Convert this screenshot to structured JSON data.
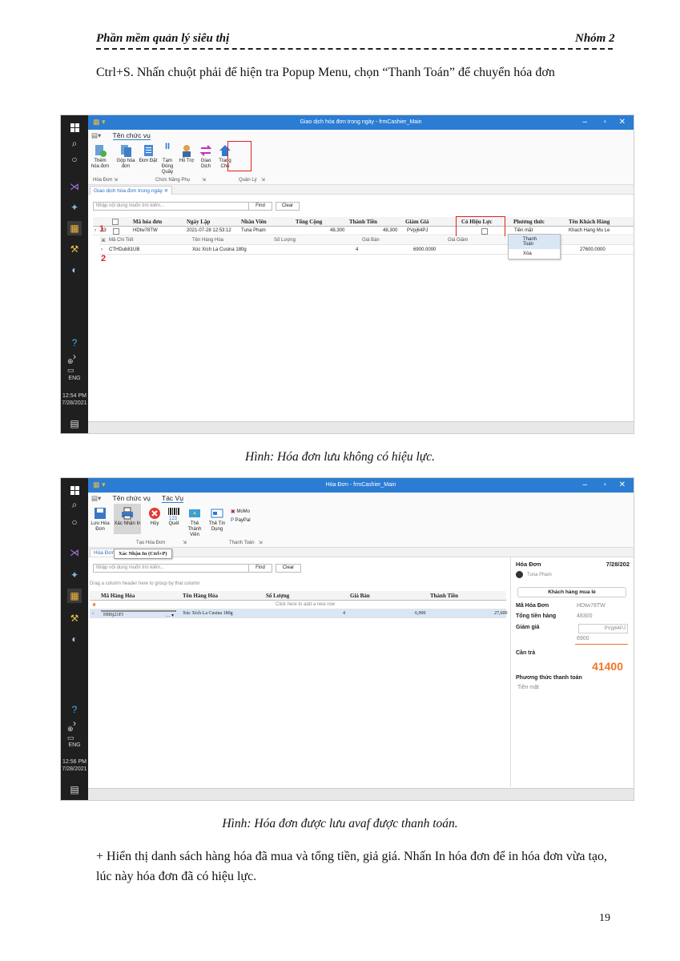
{
  "header": {
    "left": "Phần mềm quản lý siêu thị",
    "right": "Nhóm 2"
  },
  "intro": "Ctrl+S. Nhấn chuột phải để hiện tra Popup Menu, chọn “Thanh Toán” để chuyển hóa đơn",
  "fig1": {
    "window_title": "Giao dịch hóa đơn trong ngày - frmCashier_Main",
    "ribbon_tab": "Tên chức vụ",
    "buttons": [
      "Thêm hóa đơn",
      "Gộp hóa đơn",
      "Đơn Đặt",
      "Tạm Đóng Quầy",
      "Hỗ Trợ",
      "Giao Dịch",
      "Trang Chủ"
    ],
    "groups": [
      "Hóa Đơn",
      "Chức Năng Phụ",
      "Quản Lý"
    ],
    "doc_tab": "Giao dịch hóa đơn trong ngày",
    "search_placeholder": "Nhập nội dung muốn tìm kiếm...",
    "find": "Find",
    "clear": "Clear",
    "columns": [
      "Mã hóa đơn",
      "Ngày Lập",
      "Nhân Viên",
      "Tổng Cộng",
      "Thành Tiền",
      "Giảm Giá",
      "Có Hiệu Lực",
      "Phương thức",
      "Tên Khách Hàng"
    ],
    "row": {
      "ma": "HDtw78TW",
      "ngay": "2021-07-28 12:53:12",
      "nv": "Tuna Phạm",
      "tong": "48,300",
      "thanh": "48,300",
      "giam": "PVpj64PJ",
      "pt": "Tiền mặt",
      "kh": "Khach Hang Mu Le",
      "idx": "23"
    },
    "sub_columns": [
      "Mã Chi Tiết",
      "Tên Hàng Hóa",
      "Số Lượng",
      "Giá Bán",
      "Giá Giảm"
    ],
    "sub_row": {
      "ma": "CTHDub81UB",
      "ten": "Xúc Xích La Cusina 180g",
      "sl": "4",
      "gia": "6900.0000",
      "tong": "27600.0000"
    },
    "menu": [
      "Thanh Toán",
      "Xóa"
    ],
    "marker1": "1",
    "marker2": "2",
    "time": "12:54 PM",
    "date": "7/28/2021",
    "lang": "ENG",
    "caption": "Hình: Hóa đơn lưu không có hiệu lực."
  },
  "fig2": {
    "window_title": "Hóa Đơn - frmCashier_Main",
    "ribbon_tabs": [
      "Tên chức vụ",
      "Tác Vụ"
    ],
    "buttons": [
      "Lưu Hóa Đơn",
      "Xác Nhận In",
      "Hủy",
      "Quét",
      "Thẻ Thành Viên",
      "Thẻ Tín Dụng"
    ],
    "momo": "MoMo",
    "paypal": "PayPal",
    "groups": [
      "Tạo Hóa Đơn",
      "Thanh Toán"
    ],
    "doc_tab": "Hóa Đơn",
    "tooltip": "Xác Nhận In (Ctrl+P)",
    "search_placeholder": "Nhập nội dung muốn tìm kiếm...",
    "find": "Find",
    "clear": "Clear",
    "group_hint": "Drag a column header here to group by that column",
    "columns": [
      "Mã Hàng Hóa",
      "Tên Hàng Hóa",
      "Số Lượng",
      "Giá Bán",
      "Thành Tiền"
    ],
    "new_row": "Click here to add a new row",
    "row": {
      "ma": "HH6j21FJ",
      "ten": "Xúc Xích La Cusina 180g",
      "sl": "4",
      "gia": "6,900",
      "tong": "27,600"
    },
    "panel": {
      "title": "Hóa Đơn",
      "date": "7/28/202",
      "user": "Tuna Phạm",
      "customer_btn": "Khách hàng mua lẻ",
      "ma_label": "Mã Hóa Đơn",
      "ma_val": "HDtw78TW",
      "tong_label": "Tổng tiền hàng",
      "tong_val": "48300",
      "giam_label": "Giảm giá",
      "giam_code": "PVpj64PJ",
      "giam_val": "6900",
      "cantra_label": "Cần trả",
      "cantra_val": "41400",
      "pt_label": "Phương thức thanh toán",
      "pt_val": "Tiền mặt"
    },
    "time": "12:56 PM",
    "date": "7/28/2021",
    "lang": "ENG",
    "caption": "Hình: Hóa đơn được lưu avaf được thanh toán."
  },
  "outro": "+ Hiển thị danh sách hàng hóa đã mua và tổng tiền, giả giá. Nhấn In hóa đơn để in hóa đơn vừa tạo, lúc này hóa đơn đã có hiệu lực.",
  "page_number": "19",
  "colors": {
    "titlebar": "#2b7cd3",
    "taskbar": "#1f1f1f",
    "highlight": "#e02020",
    "accent": "#f07828"
  }
}
